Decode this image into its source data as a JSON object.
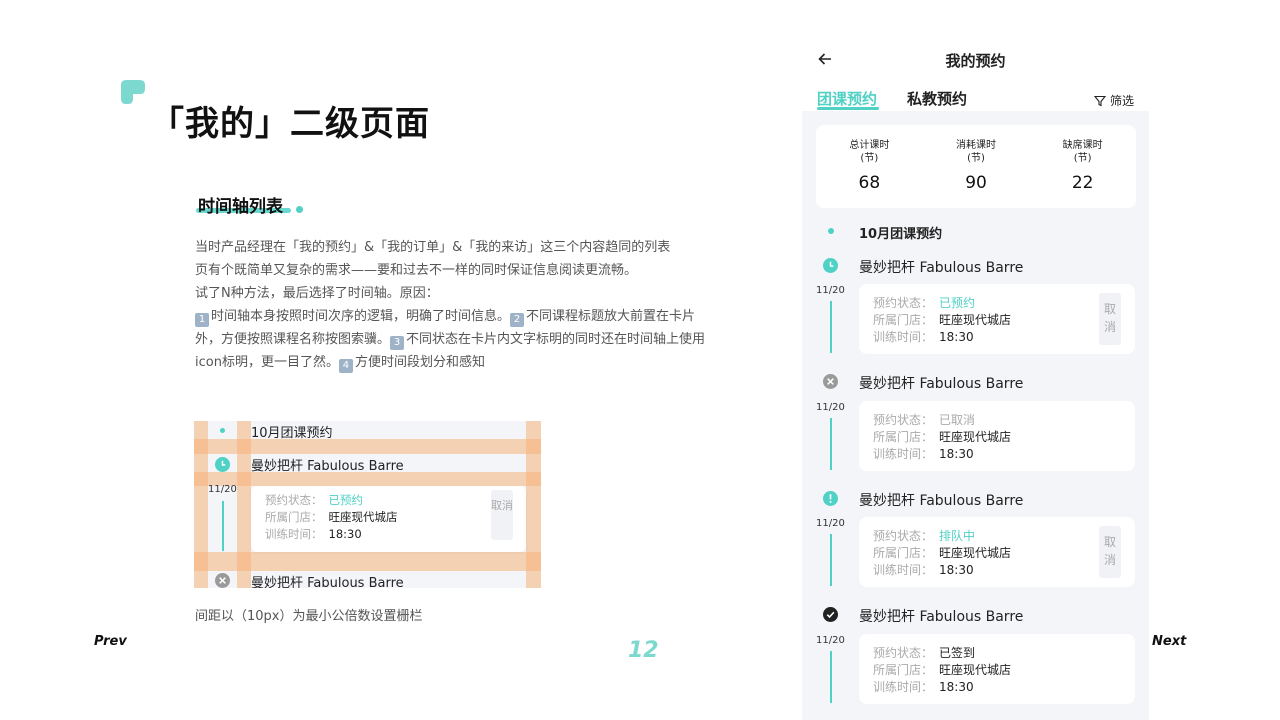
{
  "slide": {
    "title": "「我的」二级页面",
    "section_title": "时间轴列表",
    "desc_lines": [
      "当时产品经理在「我的预约」&「我的订单」&「我的来访」这三个内容趋同的列表",
      "页有个既简单又复杂的需求——要和过去不一样的同时保证信息阅读更流畅。",
      "试了N种方法，最后选择了时间轴。原因："
    ],
    "reasons": [
      {
        "n": "1",
        "t": "时间轴本身按照时间次序的逻辑，明确了时间信息。"
      },
      {
        "n": "2",
        "t": "不同课程标题放大前置在卡片外，方便按照课程名称按图索骥。"
      },
      {
        "n": "3",
        "t": "不同状态在卡片内文字标明的同时还在时间轴上使用icon标明，更一目了然。"
      },
      {
        "n": "4",
        "t": "方便时间段划分和感知"
      }
    ],
    "caption": "间距以（10px）为最小公倍数设置栅栏",
    "prev": "Prev",
    "next": "Next",
    "page_number": "12",
    "accent": "#4fd1c5"
  },
  "demo": {
    "month": "10月团课预约",
    "course": "曼妙把杆 Fabulous Barre",
    "date": "11/20",
    "status_label": "预约状态：",
    "status": "已预约",
    "store_label": "所属门店：",
    "store": "旺座现代城店",
    "time_label": "训练时间：",
    "time": "18:30",
    "cancel": "取消",
    "course2": "曼妙把杆 Fabulous Barre"
  },
  "phone": {
    "title": "我的预约",
    "tabs": [
      "团课预约",
      "私教预约"
    ],
    "filter": "筛选",
    "stats": [
      {
        "label": "总计课时",
        "unit": "(节)",
        "value": "68"
      },
      {
        "label": "消耗课时",
        "unit": "(节)",
        "value": "90"
      },
      {
        "label": "缺席课时",
        "unit": "(节)",
        "value": "22"
      }
    ],
    "month": "10月团课预约",
    "items": [
      {
        "icon": "clock-icon",
        "title": "曼妙把杆 Fabulous Barre",
        "date": "11/20",
        "status": "已预约",
        "status_highlight": true,
        "store": "旺座现代城店",
        "time": "18:30",
        "cancel": "取消"
      },
      {
        "icon": "cancelled-icon",
        "title": "曼妙把杆 Fabulous Barre",
        "date": "11/20",
        "status": "已取消",
        "status_highlight": false,
        "store": "旺座现代城店",
        "time": "18:30",
        "cancel": ""
      },
      {
        "icon": "alert-icon",
        "title": "曼妙把杆 Fabulous Barre",
        "date": "11/20",
        "status": "排队中",
        "status_highlight": true,
        "store": "旺座现代城店",
        "time": "18:30",
        "cancel": "取消"
      },
      {
        "icon": "check-icon",
        "title": "曼妙把杆 Fabulous Barre",
        "date": "11/20",
        "status": "已签到",
        "status_highlight": false,
        "store": "旺座现代城店",
        "time": "18:30",
        "cancel": ""
      }
    ],
    "labels": {
      "status": "预约状态：",
      "store": "所属门店：",
      "time": "训练时间："
    }
  }
}
